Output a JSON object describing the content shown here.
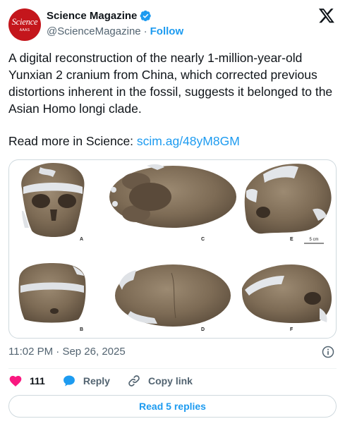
{
  "author": {
    "name": "Science Magazine",
    "handle": "@ScienceMagazine",
    "follow_label": "Follow",
    "avatar_word": "Science",
    "avatar_sub": "AAAS"
  },
  "tweet": {
    "text": "A digital reconstruction of the nearly 1-million-year-old Yunxian 2 cranium from China, which corrected previous distortions inherent in the fossil, suggests it belonged to the Asian Homo longi clade.",
    "read_more_prefix": "Read more in Science: ",
    "link_text": "scim.ag/48yM8GM"
  },
  "figure": {
    "labels": [
      "A",
      "C",
      "E",
      "B",
      "D",
      "F"
    ],
    "scale_label": "5 cm"
  },
  "meta": {
    "time": "11:02 PM",
    "separator": "·",
    "date": "Sep 26, 2025"
  },
  "actions": {
    "likes": "111",
    "reply_label": "Reply",
    "copy_label": "Copy link"
  },
  "read_replies_label": "Read 5 replies",
  "colors": {
    "accent": "#1d9bf0",
    "like": "#f91880",
    "brand": "#c4161c",
    "muted": "#536471"
  }
}
